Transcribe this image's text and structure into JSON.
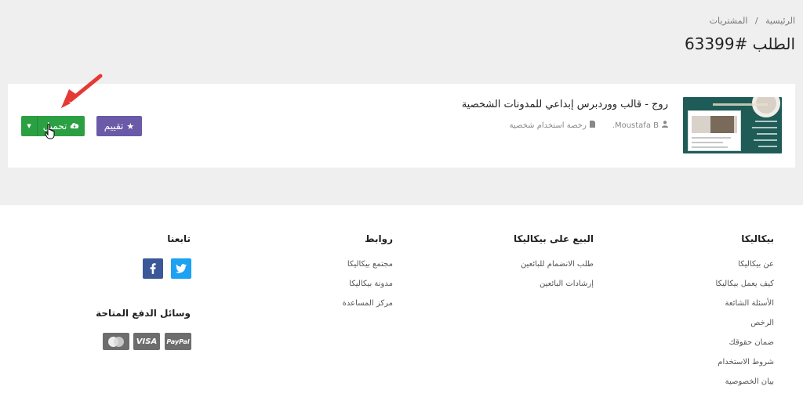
{
  "breadcrumb": {
    "home": "الرئيسية",
    "separator": "/",
    "current": "المشتريات"
  },
  "page_title": "الطلب #63399",
  "order": {
    "product_name": "روج - قالب ووردبرس إبداعي للمدونات الشخصية",
    "author": "Moustafa B.",
    "license": "رخصة استخدام شخصية",
    "rate_button": "تقييم",
    "download_button": "تحميل"
  },
  "footer": {
    "col1": {
      "title": "بيكاليكا",
      "links": [
        "عن بيكاليكا",
        "كيف يعمل بيكاليكا",
        "الأسئلة الشائعة",
        "الرخص",
        "ضمان حقوقك",
        "شروط الاستخدام",
        "بيان الخصوصية"
      ]
    },
    "col2": {
      "title": "البيع على بيكاليكا",
      "links": [
        "طلب الانضمام للبائعين",
        "إرشادات البائعين"
      ]
    },
    "col3": {
      "title": "روابط",
      "links": [
        "مجتمع بيكاليكا",
        "مدونة بيكاليكا",
        "مركز المساعدة"
      ]
    },
    "col4": {
      "title": "تابعنا"
    },
    "payment_title": "وسائل الدفع المتاحة",
    "payment_cards": {
      "paypal": "PayPal",
      "visa": "VISA"
    }
  },
  "colors": {
    "download": "#2ba043",
    "rate": "#6a5aa8",
    "twitter": "#1da1f2",
    "facebook": "#3b5998",
    "annotation_arrow": "#e53935"
  }
}
